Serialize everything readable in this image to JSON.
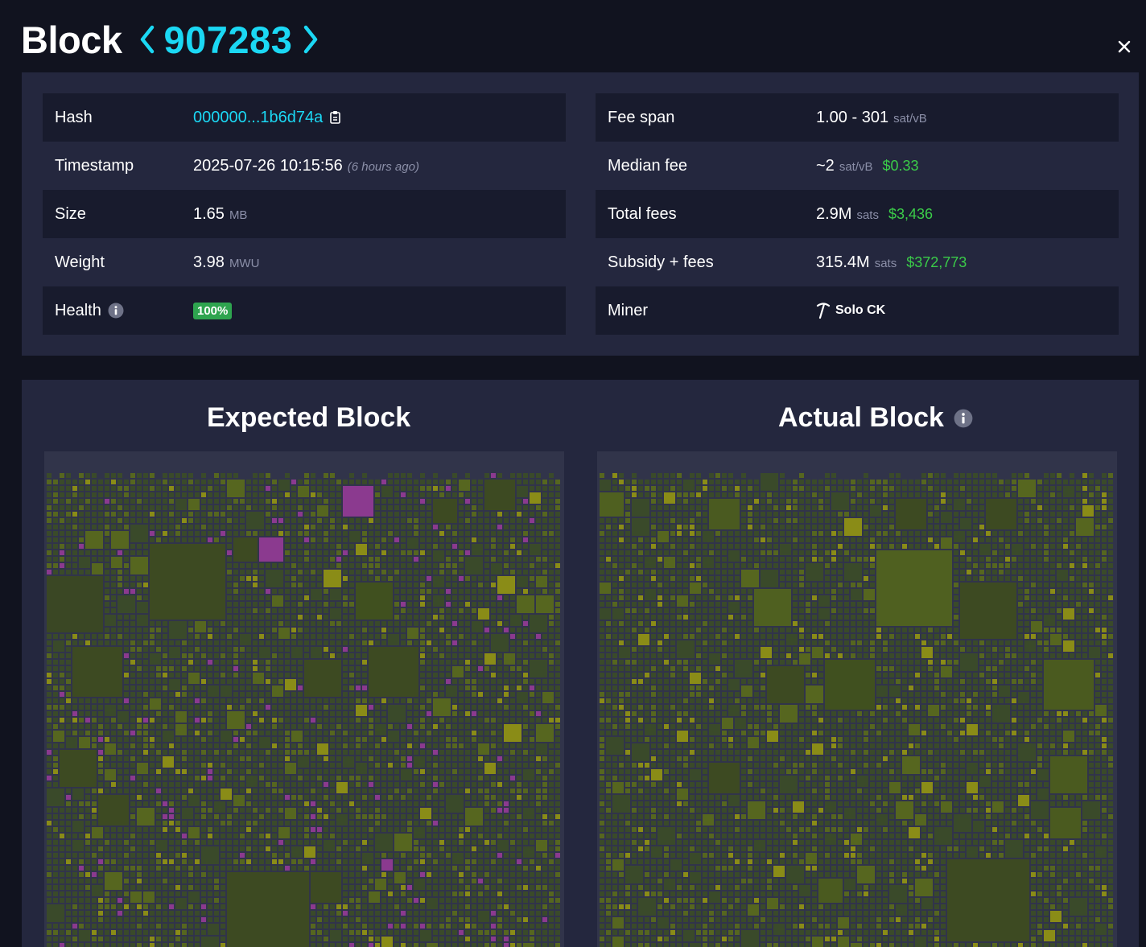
{
  "header": {
    "title": "Block",
    "height": "907283"
  },
  "details": {
    "left": [
      {
        "label": "Hash",
        "value": "000000...1b6d74a"
      },
      {
        "label": "Timestamp",
        "value": "2025-07-26 10:15:56",
        "note": "(6 hours ago)"
      },
      {
        "label": "Size",
        "value": "1.65",
        "unit": "MB"
      },
      {
        "label": "Weight",
        "value": "3.98",
        "unit": "MWU"
      },
      {
        "label": "Health",
        "badge": "100%"
      }
    ],
    "right": [
      {
        "label": "Fee span",
        "value": "1.00 - 301",
        "unit": "sat/vB"
      },
      {
        "label": "Median fee",
        "value": "~2",
        "unit": "sat/vB",
        "usd": "$0.33"
      },
      {
        "label": "Total fees",
        "value": "2.9M",
        "unit": "sats",
        "usd": "$3,436"
      },
      {
        "label": "Subsidy + fees",
        "value": "315.4M",
        "unit": "sats",
        "usd": "$372,773"
      },
      {
        "label": "Miner",
        "value": "Solo CK"
      }
    ]
  },
  "audit": {
    "expected_title": "Expected Block",
    "actual_title": "Actual Block"
  },
  "colors": {
    "accent": "#1bd8f4",
    "usd_green": "#3bcc49",
    "health_green": "#2ea44f",
    "tx_dark": "#3a4a2a",
    "tx_olive": "#56661f",
    "tx_yellow": "#8a8c17",
    "tx_added": "#8b3a8f"
  }
}
